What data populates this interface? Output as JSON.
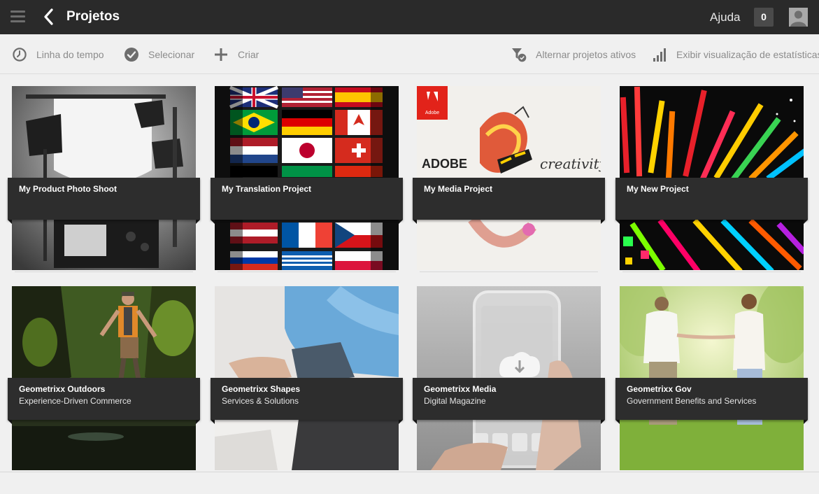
{
  "header": {
    "title": "Projetos",
    "help_label": "Ajuda",
    "notification_count": "0"
  },
  "toolbar": {
    "timeline_label": "Linha do tempo",
    "select_label": "Selecionar",
    "create_label": "Criar",
    "toggle_active_label": "Alternar projetos ativos",
    "stats_label": "Exibir visualização de estatísticas"
  },
  "icons": {
    "menu": "hamburger-icon",
    "back": "chevron-left-icon",
    "avatar": "user-avatar-icon",
    "timeline": "clock-icon",
    "select": "checkmark-circle-icon",
    "create": "plus-icon",
    "toggle_active": "filter-check-icon",
    "stats": "bar-chart-icon"
  },
  "colors": {
    "topbar": "#2a2a2a",
    "card_band": "#2d2d2d",
    "toolbar_text": "#8b8b8b",
    "adobe_red": "#e2231a"
  },
  "projects": [
    {
      "title": "My Product Photo Shoot",
      "subtitle": "",
      "thumbnail": "photo-studio-image"
    },
    {
      "title": "My Translation Project",
      "subtitle": "",
      "thumbnail": "world-flags-image"
    },
    {
      "title": "My Media Project",
      "subtitle": "",
      "thumbnail": "adobe-creativity-image",
      "thumbnail_text": [
        "Adobe",
        "ADOBE",
        "creativity"
      ]
    },
    {
      "title": "My New Project",
      "subtitle": "",
      "thumbnail": "colorful-bars-image"
    },
    {
      "title": "Geometrixx Outdoors",
      "subtitle": "Experience-Driven Commerce",
      "thumbnail": "hiker-gorge-image"
    },
    {
      "title": "Geometrixx Shapes",
      "subtitle": "Services & Solutions",
      "thumbnail": "laptop-user-image"
    },
    {
      "title": "Geometrixx Media",
      "subtitle": "Digital Magazine",
      "thumbnail": "transparent-phone-image"
    },
    {
      "title": "Geometrixx Gov",
      "subtitle": "Government Benefits and Services",
      "thumbnail": "couple-meadow-image"
    }
  ]
}
